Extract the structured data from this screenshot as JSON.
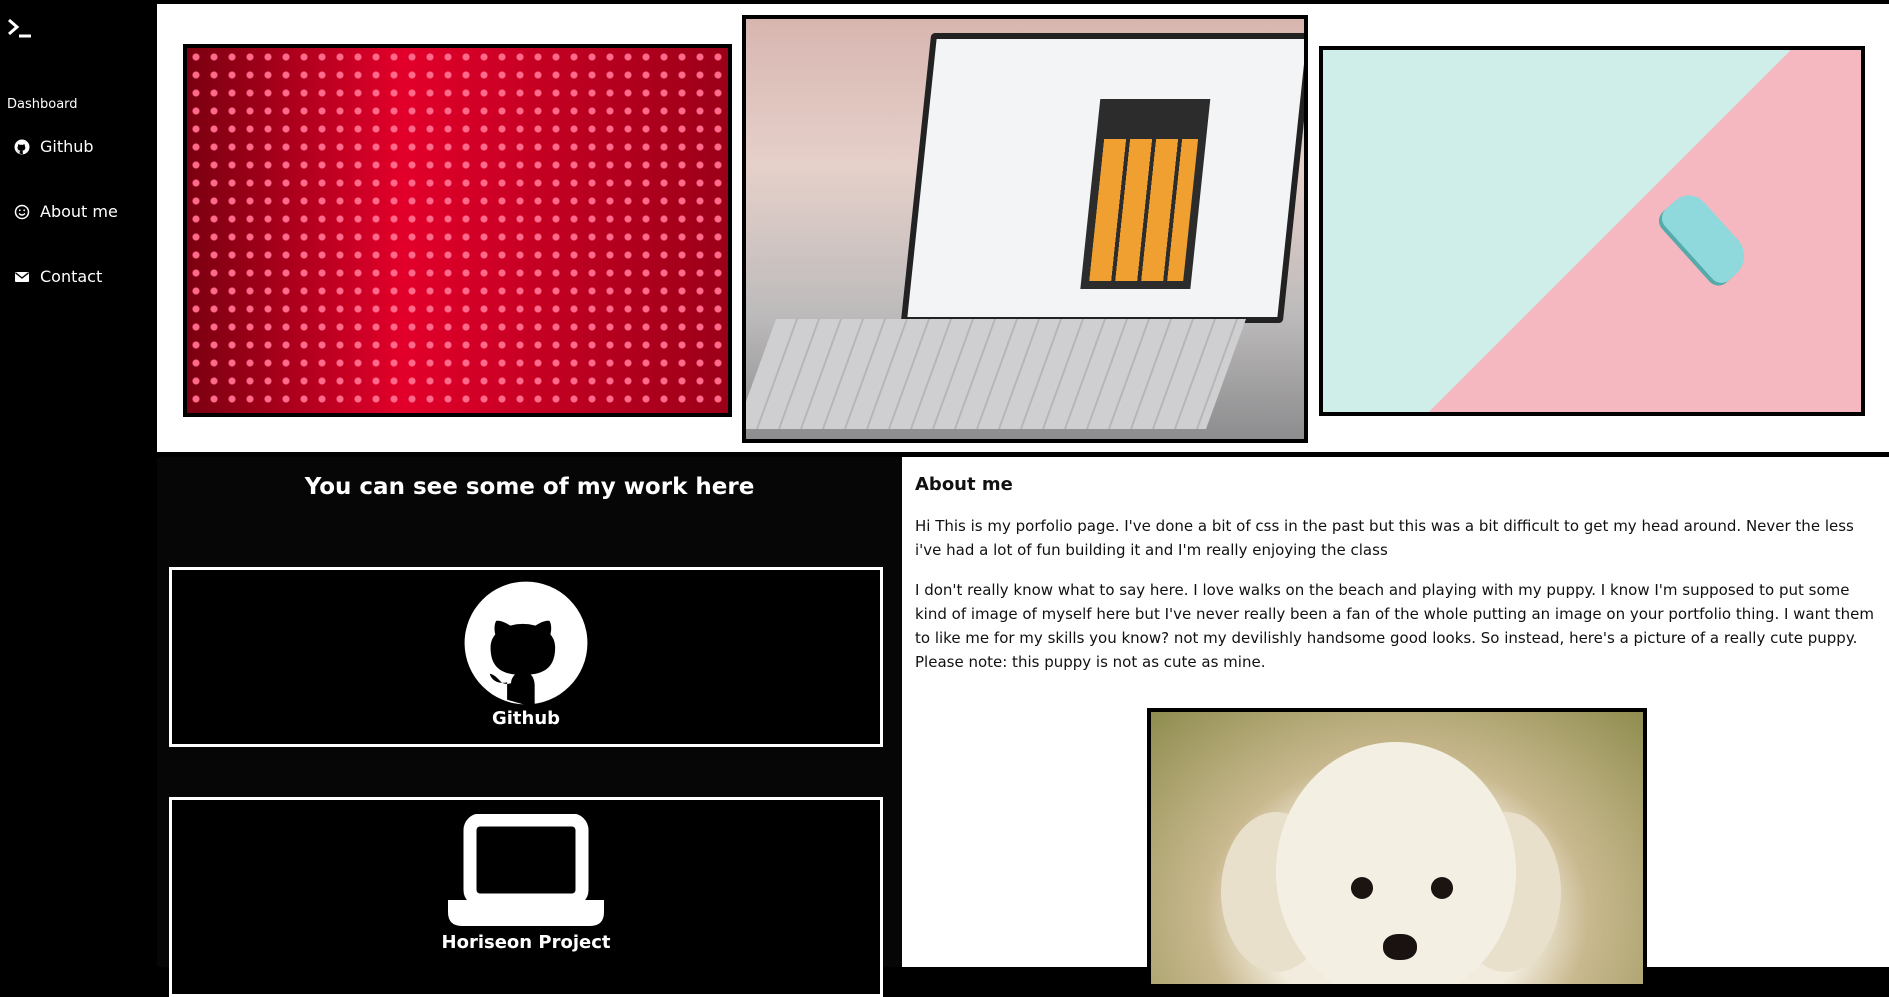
{
  "sidebar": {
    "logo_icon": "terminal-prompt-icon",
    "section_label": "Dashboard",
    "items": [
      {
        "label": "Github",
        "icon": "github-icon"
      },
      {
        "label": "About me",
        "icon": "smiley-icon"
      },
      {
        "label": "Contact",
        "icon": "envelope-icon"
      }
    ]
  },
  "gallery": {
    "images": [
      {
        "name": "red-led-wall"
      },
      {
        "name": "laptop-calculator"
      },
      {
        "name": "toy-car-pastel"
      }
    ]
  },
  "work": {
    "title": "You can see some of my work here",
    "cards": [
      {
        "label": "Github",
        "icon": "github-icon"
      },
      {
        "label": "Horiseon Project",
        "icon": "laptop-icon"
      }
    ]
  },
  "about": {
    "heading": "About me",
    "paragraph1": "Hi This is my porfolio page. I've done a bit of css in the past but this was a bit difficult to get my head around. Never the less i've had a lot of fun building it and I'm really enjoying the class",
    "paragraph2": "I don't really know what to say here. I love walks on the beach and playing with my puppy. I know I'm supposed to put some kind of image of myself here but I've never really been a fan of the whole putting an image on your portfolio thing. I want them to like me for my skills you know? not my devilishly handsome good looks. So instead, here's a picture of a really cute puppy. Please note: this puppy is not as cute as mine.",
    "image": "puppy-photo"
  },
  "colors": {
    "sidebar_bg": "#000000",
    "work_bg": "#060606",
    "about_bg": "#ffffff",
    "gallery_bg": "#ffffff"
  }
}
